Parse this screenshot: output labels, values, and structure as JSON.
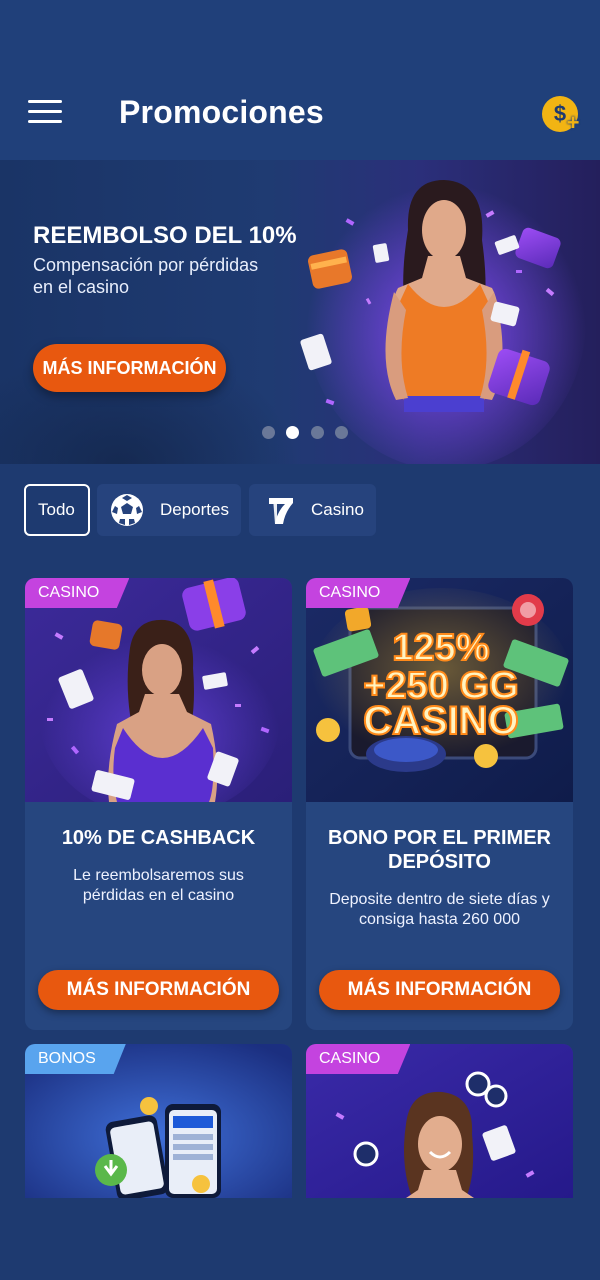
{
  "header": {
    "title": "Promociones",
    "menu_icon": "hamburger-menu-icon",
    "coin_icon": "dollar-coin-plus-icon",
    "coin_symbol": "$",
    "coin_plus": "+"
  },
  "banner": {
    "title": "REEMBOLSO DEL 10%",
    "subtitle": "Compensación por pérdidas en el casino",
    "button": "MÁS INFORMACIÓN",
    "slides": 4,
    "active_slide": 2
  },
  "filters": [
    {
      "label": "Todo",
      "icon": "",
      "active": true
    },
    {
      "label": "Deportes",
      "icon": "soccer-ball-icon",
      "active": false
    },
    {
      "label": "Casino",
      "icon": "seven-icon",
      "active": false
    }
  ],
  "cards": [
    {
      "tag": "CASINO",
      "title": "10% DE CASHBACK",
      "description": "Le reembolsaremos sus pérdidas en el casino",
      "button": "MÁS INFORMACIÓN"
    },
    {
      "tag": "CASINO",
      "title": "BONO POR EL PRIMER DEPÓSITO",
      "description": "Deposite dentro de siete días y consiga hasta  260 000",
      "button": "MÁS INFORMACIÓN",
      "image_text": [
        "125%",
        "+250 GG",
        "CASINO"
      ]
    },
    {
      "tag": "BONOS"
    },
    {
      "tag": "CASINO"
    }
  ],
  "colors": {
    "background": "#1e3a70",
    "header": "#20407a",
    "card": "#26467f",
    "accent_orange": "#e8580f",
    "tag_casino": "#c443df",
    "tag_bonos": "#59a4ee",
    "coin": "#f2b413"
  }
}
